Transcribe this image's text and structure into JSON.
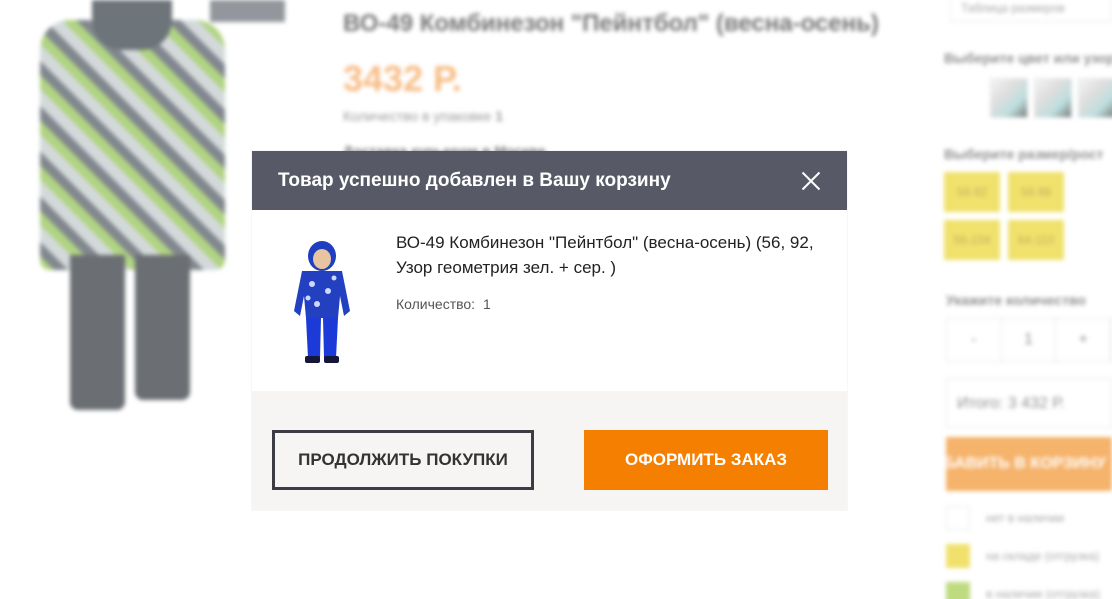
{
  "background": {
    "title": "ВО-49 Комбинезон \"Пейнтбол\" (весна-осень)",
    "price": "3432 Р.",
    "qty_label": "Количество в упаковке",
    "qty_value": "1",
    "delivery": "Доставка курьером в Москве",
    "size_chart": "Таблица размеров",
    "color_label": "Выберите цвет или узор",
    "size_label": "Выберите размер/рост",
    "sizes": [
      "56-92",
      "56-98",
      "56-104",
      "64-110"
    ],
    "qty_select_label": "Укажите количество",
    "stepper": {
      "minus": "-",
      "value": "1",
      "plus": "+"
    },
    "total": "Итого: 3 432 Р.",
    "add_button": "ДОБАВИТЬ В КОРЗИНУ",
    "legend": [
      {
        "text": "нет в наличии",
        "color": "#ffffff"
      },
      {
        "text": "на складе (отгрузка)",
        "color": "#e8d21f"
      },
      {
        "text": "в наличии (отгрузка)",
        "color": "#9bc83c"
      }
    ]
  },
  "modal": {
    "title": "Товар успешно добавлен в Вашу корзину",
    "item_name": "ВО-49 Комбинезон \"Пейнтбол\" (весна-осень) (56, 92, Узор геометрия зел. + сер. )",
    "qty_label": "Количество:",
    "qty_value": "1",
    "continue_button": "ПРОДОЛЖИТЬ ПОКУПКИ",
    "checkout_button": "ОФОРМИТЬ ЗАКАЗ"
  },
  "colors": {
    "header_bg": "#575a66",
    "accent_orange": "#f57f00",
    "footer_bg": "#f6f5f3"
  }
}
